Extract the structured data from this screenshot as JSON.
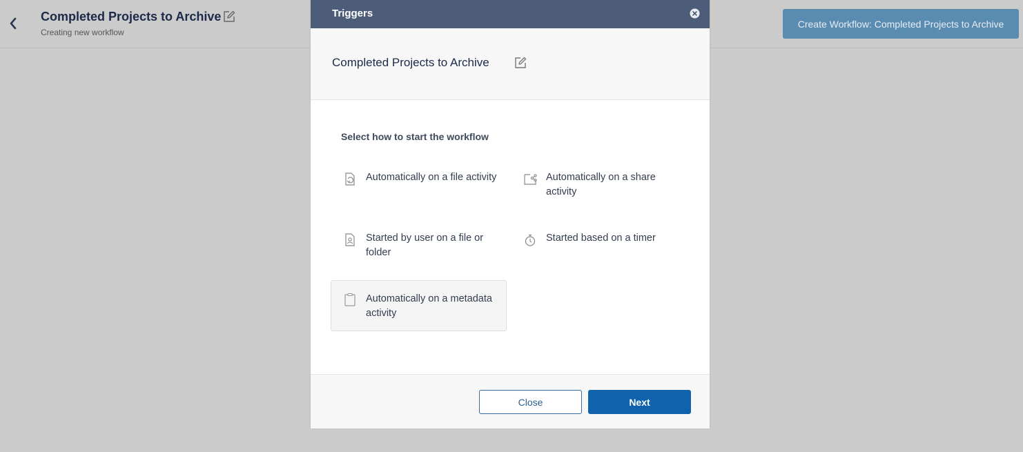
{
  "page": {
    "title": "Completed Projects to Archive",
    "subtitle": "Creating new workflow",
    "create_button": "Create Workflow: Completed Projects to Archive"
  },
  "modal": {
    "title": "Triggers",
    "workflow_name": "Completed Projects to Archive",
    "section_label": "Select how to start the workflow",
    "options": [
      {
        "label": "Automatically on a file activity",
        "icon": "file-activity-icon",
        "selected": false
      },
      {
        "label": "Automatically on a share activity",
        "icon": "share-activity-icon",
        "selected": false
      },
      {
        "label": "Started by user on a file or folder",
        "icon": "user-file-icon",
        "selected": false
      },
      {
        "label": "Started based on a timer",
        "icon": "timer-icon",
        "selected": false
      },
      {
        "label": "Automatically on a metadata activity",
        "icon": "clipboard-icon",
        "selected": true
      }
    ],
    "close_button": "Close",
    "next_button": "Next"
  },
  "colors": {
    "overlay_bg": "#cccccc",
    "modal_header": "#4d5c78",
    "primary": "#0f62ab",
    "create_button_dimmed": "#5a8bb1"
  }
}
